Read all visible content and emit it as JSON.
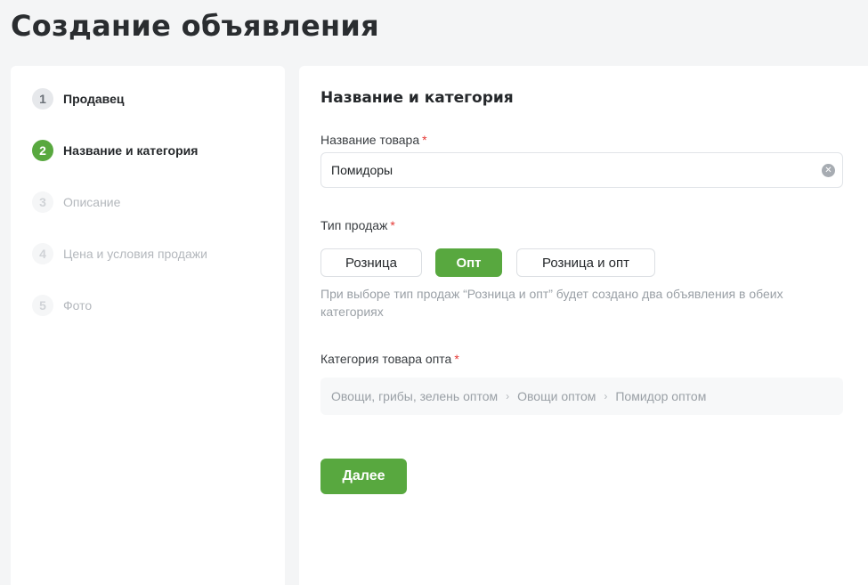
{
  "page": {
    "title": "Создание объявления"
  },
  "steps": [
    {
      "num": "1",
      "label": "Продавец",
      "state": "done"
    },
    {
      "num": "2",
      "label": "Название и категория",
      "state": "active"
    },
    {
      "num": "3",
      "label": "Описание",
      "state": "pending"
    },
    {
      "num": "4",
      "label": "Цена и условия продажи",
      "state": "pending"
    },
    {
      "num": "5",
      "label": "Фото",
      "state": "pending"
    }
  ],
  "form": {
    "section_title": "Название и категория",
    "product_name": {
      "label": "Название товара",
      "required_mark": "*",
      "value": "Помидоры"
    },
    "sale_type": {
      "label": "Тип продаж",
      "required_mark": "*",
      "options": [
        "Розница",
        "Опт",
        "Розница и опт"
      ],
      "selected": "Опт",
      "hint": "При выборе тип продаж “Розница и опт” будет создано два объявления в обеих категориях"
    },
    "category": {
      "label": "Категория товара опта",
      "required_mark": "*",
      "path": [
        "Овощи, грибы, зелень оптом",
        "Овощи оптом",
        "Помидор оптом"
      ],
      "separator": "›"
    },
    "next_label": "Далее"
  },
  "colors": {
    "accent": "#58a83f",
    "required": "#e53935",
    "muted": "#9aa0a6"
  }
}
